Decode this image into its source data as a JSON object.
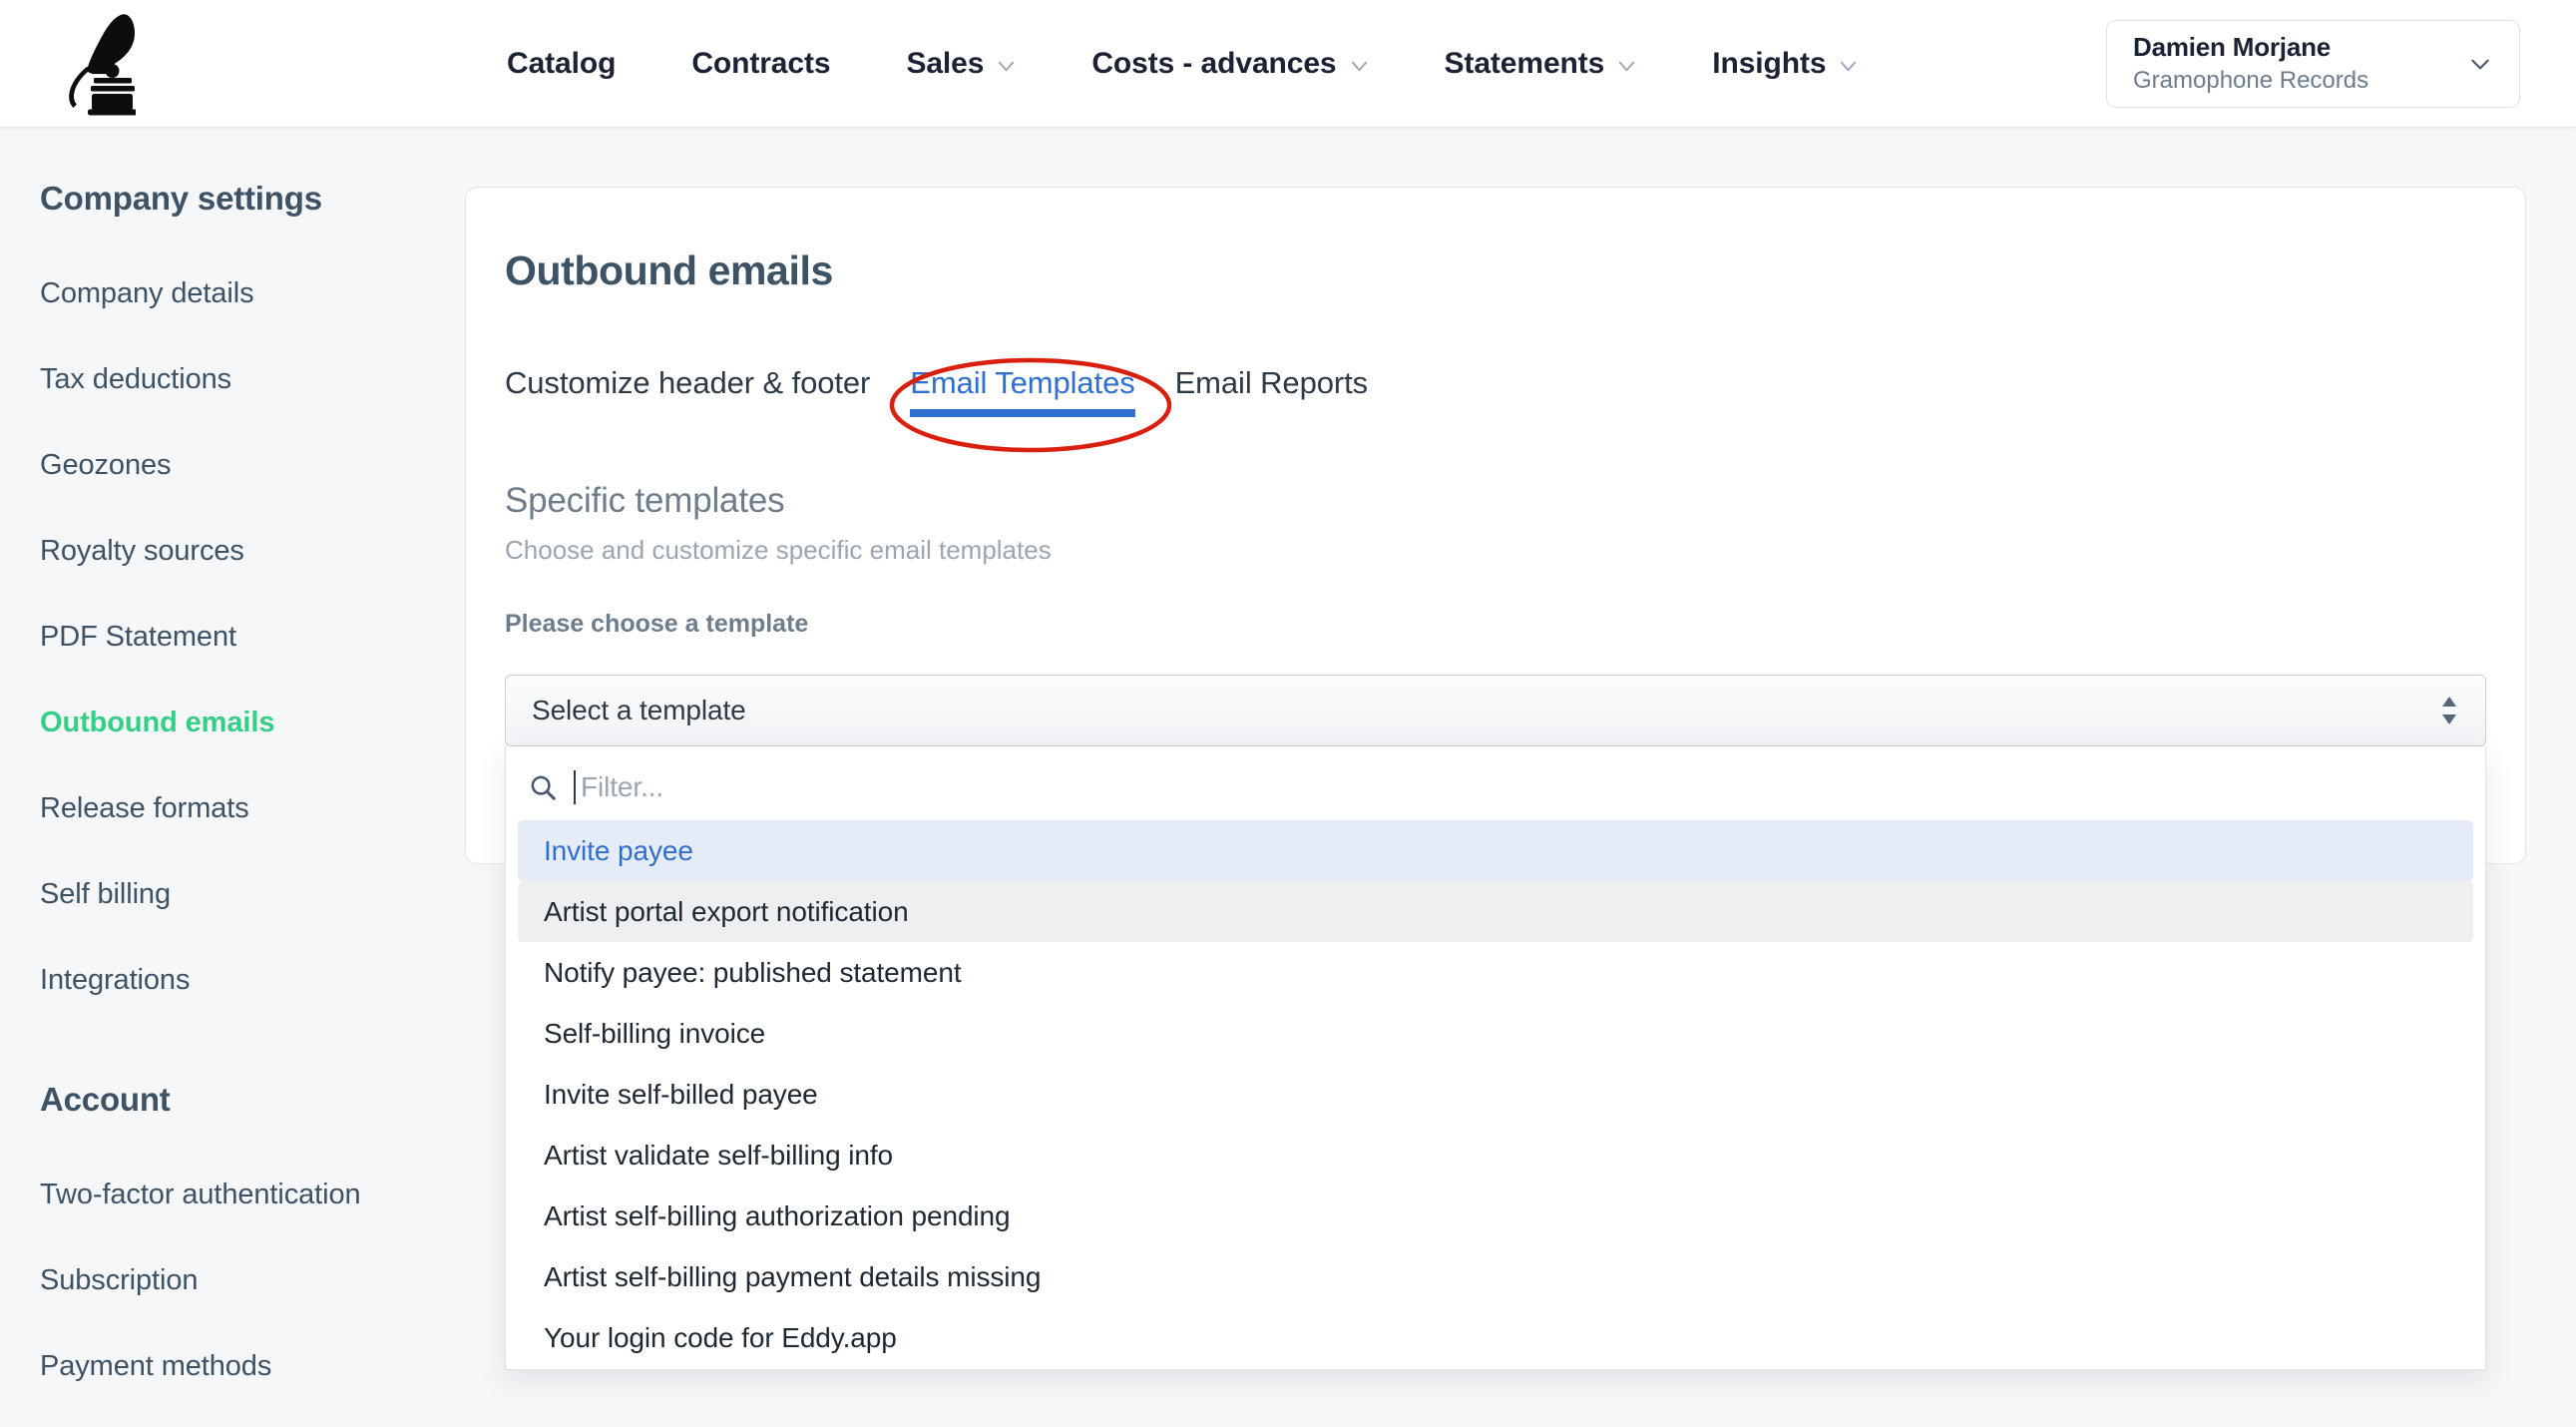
{
  "header": {
    "logo_icon": "gramophone-logo",
    "nav": [
      {
        "label": "Catalog",
        "has_chevron": false
      },
      {
        "label": "Contracts",
        "has_chevron": false
      },
      {
        "label": "Sales",
        "has_chevron": true
      },
      {
        "label": "Costs - advances",
        "has_chevron": true
      },
      {
        "label": "Statements",
        "has_chevron": true
      },
      {
        "label": "Insights",
        "has_chevron": true
      }
    ],
    "user": {
      "name": "Damien Morjane",
      "company": "Gramophone Records",
      "chevron_icon": "chevron-down-icon"
    }
  },
  "sidebar": {
    "sections": [
      {
        "title": "Company settings",
        "items": [
          {
            "label": "Company details",
            "active": false
          },
          {
            "label": "Tax deductions",
            "active": false
          },
          {
            "label": "Geozones",
            "active": false
          },
          {
            "label": "Royalty sources",
            "active": false
          },
          {
            "label": "PDF Statement",
            "active": false
          },
          {
            "label": "Outbound emails",
            "active": true
          },
          {
            "label": "Release formats",
            "active": false
          },
          {
            "label": "Self billing",
            "active": false
          },
          {
            "label": "Integrations",
            "active": false
          }
        ]
      },
      {
        "title": "Account",
        "items": [
          {
            "label": "Two-factor authentication",
            "active": false
          },
          {
            "label": "Subscription",
            "active": false
          },
          {
            "label": "Payment methods",
            "active": false
          }
        ]
      }
    ]
  },
  "main": {
    "title": "Outbound emails",
    "tabs": [
      {
        "label": "Customize header & footer",
        "active": false
      },
      {
        "label": "Email Templates",
        "active": true
      },
      {
        "label": "Email Reports",
        "active": false
      }
    ],
    "section": {
      "title": "Specific templates",
      "subtitle": "Choose and customize specific email templates",
      "field_label": "Please choose a template"
    },
    "select": {
      "value": "Select a template",
      "stepper_icon": "stepper-up-down-icon"
    },
    "dropdown": {
      "search_icon": "search-icon",
      "filter_placeholder": "Filter...",
      "options": [
        {
          "label": "Invite payee",
          "state": "selected"
        },
        {
          "label": "Artist portal export notification",
          "state": "hover"
        },
        {
          "label": "Notify payee: published statement",
          "state": "normal"
        },
        {
          "label": "Self-billing invoice",
          "state": "normal"
        },
        {
          "label": "Invite self-billed payee",
          "state": "normal"
        },
        {
          "label": "Artist validate self-billing info",
          "state": "normal"
        },
        {
          "label": "Artist self-billing authorization pending",
          "state": "normal"
        },
        {
          "label": "Artist self-billing payment details missing",
          "state": "normal"
        },
        {
          "label": "Your login code for Eddy.app",
          "state": "normal"
        }
      ]
    }
  },
  "annotation": {
    "shape": "ellipse-highlight",
    "color": "#d9200f",
    "target": "Email Templates"
  },
  "colors": {
    "page_bg": "#f6f7f9",
    "accent_green": "#34cf86",
    "accent_blue": "#2f6fd0",
    "nav_text": "#1b2233",
    "body_text": "#3d5264",
    "annotation_red": "#d9200f"
  }
}
